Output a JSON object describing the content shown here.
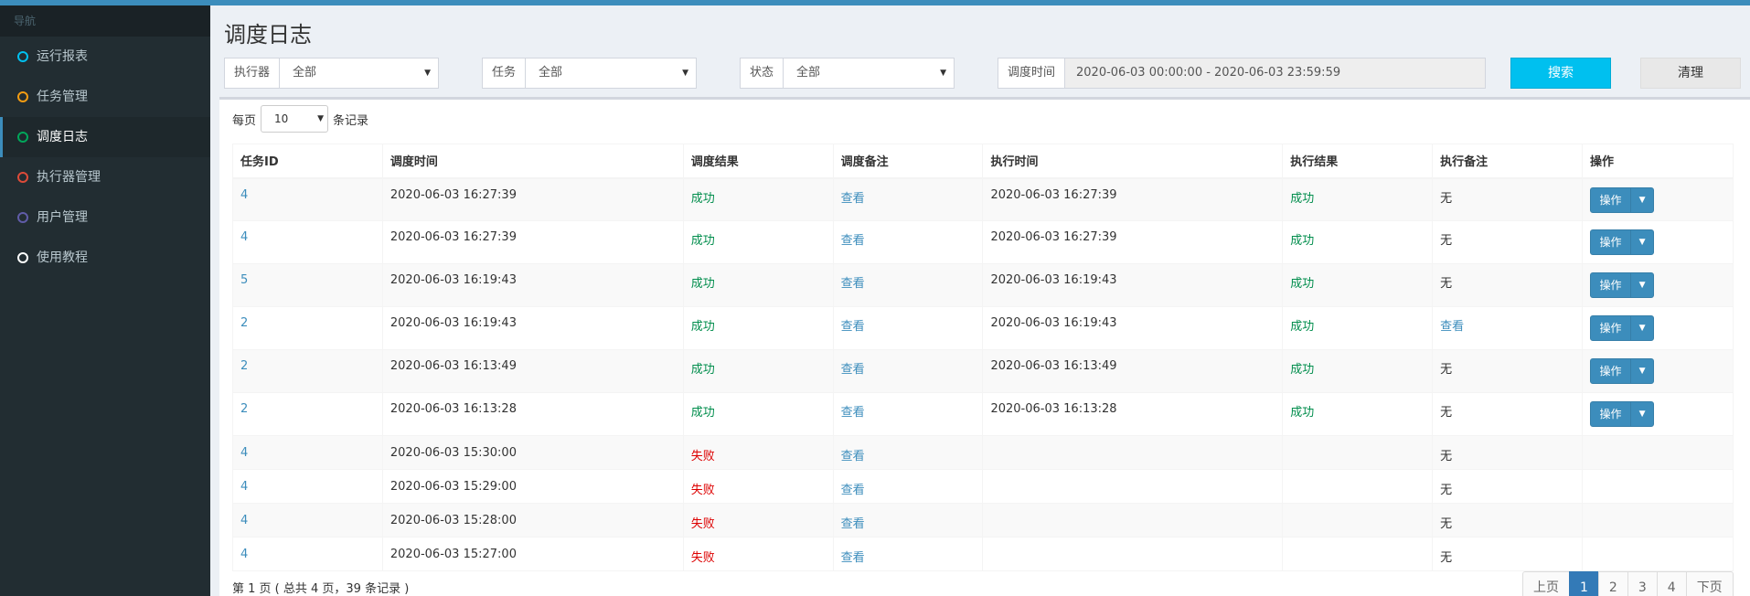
{
  "sidebar": {
    "header": "导航",
    "items": [
      {
        "label": "运行报表",
        "color": "#00c0ef",
        "active": false
      },
      {
        "label": "任务管理",
        "color": "#f39c12",
        "active": false
      },
      {
        "label": "调度日志",
        "color": "#00a65a",
        "active": true
      },
      {
        "label": "执行器管理",
        "color": "#dd4b39",
        "active": false
      },
      {
        "label": "用户管理",
        "color": "#605ca8",
        "active": false
      },
      {
        "label": "使用教程",
        "color": "#ffffff",
        "active": false
      }
    ]
  },
  "page": {
    "title": "调度日志"
  },
  "filters": {
    "executor": {
      "label": "执行器",
      "value": "全部"
    },
    "job": {
      "label": "任务",
      "value": "全部"
    },
    "status": {
      "label": "状态",
      "value": "全部"
    },
    "time": {
      "label": "调度时间",
      "value": "2020-06-03 00:00:00 - 2020-06-03 23:59:59"
    },
    "search_label": "搜索",
    "clear_label": "清理"
  },
  "pagesize": {
    "prefix": "每页",
    "value": "10",
    "suffix": "条记录"
  },
  "table": {
    "headers": [
      "任务ID",
      "调度时间",
      "调度结果",
      "调度备注",
      "执行时间",
      "执行结果",
      "执行备注",
      "操作"
    ],
    "rows": [
      {
        "id": "4",
        "trigger_time": "2020-06-03 16:27:39",
        "trigger_result": "成功",
        "trigger_msg": "查看",
        "handle_time": "2020-06-03 16:27:39",
        "handle_result": "成功",
        "handle_msg": "无",
        "op": "操作"
      },
      {
        "id": "4",
        "trigger_time": "2020-06-03 16:27:39",
        "trigger_result": "成功",
        "trigger_msg": "查看",
        "handle_time": "2020-06-03 16:27:39",
        "handle_result": "成功",
        "handle_msg": "无",
        "op": "操作"
      },
      {
        "id": "5",
        "trigger_time": "2020-06-03 16:19:43",
        "trigger_result": "成功",
        "trigger_msg": "查看",
        "handle_time": "2020-06-03 16:19:43",
        "handle_result": "成功",
        "handle_msg": "无",
        "op": "操作"
      },
      {
        "id": "2",
        "trigger_time": "2020-06-03 16:19:43",
        "trigger_result": "成功",
        "trigger_msg": "查看",
        "handle_time": "2020-06-03 16:19:43",
        "handle_result": "成功",
        "handle_msg": "查看",
        "op": "操作"
      },
      {
        "id": "2",
        "trigger_time": "2020-06-03 16:13:49",
        "trigger_result": "成功",
        "trigger_msg": "查看",
        "handle_time": "2020-06-03 16:13:49",
        "handle_result": "成功",
        "handle_msg": "无",
        "op": "操作"
      },
      {
        "id": "2",
        "trigger_time": "2020-06-03 16:13:28",
        "trigger_result": "成功",
        "trigger_msg": "查看",
        "handle_time": "2020-06-03 16:13:28",
        "handle_result": "成功",
        "handle_msg": "无",
        "op": "操作"
      },
      {
        "id": "4",
        "trigger_time": "2020-06-03 15:30:00",
        "trigger_result": "失败",
        "trigger_msg": "查看",
        "handle_time": "",
        "handle_result": "",
        "handle_msg": "无",
        "op": ""
      },
      {
        "id": "4",
        "trigger_time": "2020-06-03 15:29:00",
        "trigger_result": "失败",
        "trigger_msg": "查看",
        "handle_time": "",
        "handle_result": "",
        "handle_msg": "无",
        "op": ""
      },
      {
        "id": "4",
        "trigger_time": "2020-06-03 15:28:00",
        "trigger_result": "失败",
        "trigger_msg": "查看",
        "handle_time": "",
        "handle_result": "",
        "handle_msg": "无",
        "op": ""
      },
      {
        "id": "4",
        "trigger_time": "2020-06-03 15:27:00",
        "trigger_result": "失败",
        "trigger_msg": "查看",
        "handle_time": "",
        "handle_result": "",
        "handle_msg": "无",
        "op": ""
      }
    ]
  },
  "pagination": {
    "info": "第 1 页 ( 总共 4 页，39 条记录 )",
    "prev": "上页",
    "pages": [
      "1",
      "2",
      "3",
      "4"
    ],
    "current": "1",
    "next": "下页"
  },
  "colors": {
    "accent": "#3c8dbc",
    "success": "#008d4c",
    "fail": "#dd0000",
    "search_btn": "#00c0ef"
  }
}
